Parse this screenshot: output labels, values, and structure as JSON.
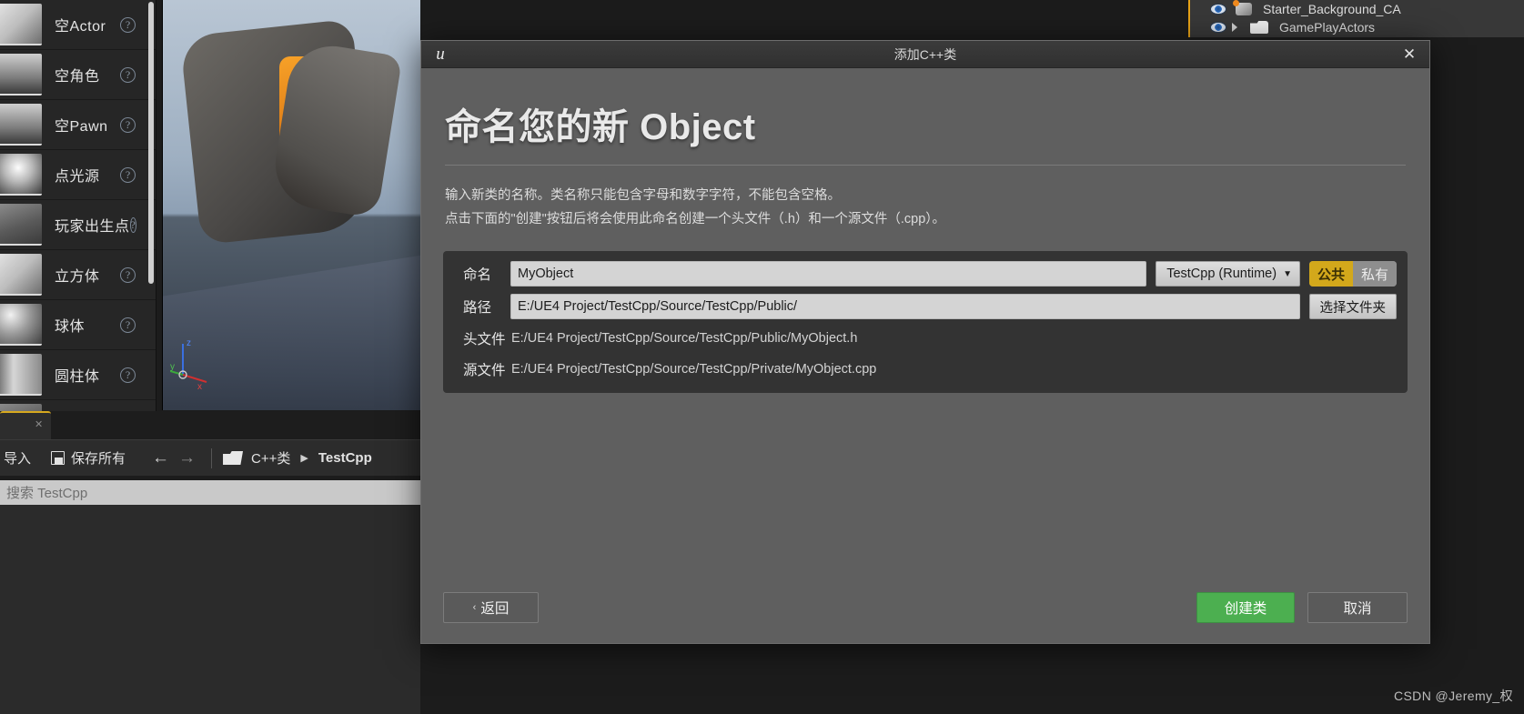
{
  "editor": {
    "place_panel": {
      "items": [
        {
          "label": "空Actor",
          "thumb": "cube",
          "help": "?"
        },
        {
          "label": "空角色",
          "thumb": "pawn",
          "help": "?"
        },
        {
          "label": "空Pawn",
          "thumb": "pawn",
          "help": "?"
        },
        {
          "label": "点光源",
          "thumb": "bulb",
          "help": "?"
        },
        {
          "label": "玩家出生点",
          "thumb": "cube",
          "help": "?"
        },
        {
          "label": "立方体",
          "thumb": "cube",
          "help": "?"
        },
        {
          "label": "球体",
          "thumb": "sphere",
          "help": "?"
        },
        {
          "label": "圆柱体",
          "thumb": "cyl",
          "help": "?"
        }
      ]
    },
    "outliner": {
      "rows": [
        {
          "name": "Starter_Background_CA",
          "type": "mesh"
        },
        {
          "name": "GamePlayActors",
          "type": "folder"
        }
      ]
    },
    "content_browser": {
      "tab_close": "✕",
      "toolbar": {
        "import_label": "导入",
        "save_all_label": "保存所有",
        "back_arrow": "←",
        "forward_arrow": "→",
        "crumb_root": "C++类",
        "crumb_sep": "▶",
        "crumb_current": "TestCpp"
      },
      "search_placeholder": "搜索 TestCpp"
    }
  },
  "dialog": {
    "title": "添加C++类",
    "logo": "unreal-logo",
    "close": "✕",
    "heading": "命名您的新 Object",
    "description": [
      "输入新类的名称。类名称只能包含字母和数字字符，不能包含空格。",
      "点击下面的\"创建\"按钮后将会使用此命名创建一个头文件（.h）和一个源文件（.cpp）。"
    ],
    "form": {
      "name_label": "命名",
      "name_value": "MyObject",
      "module_value": "TestCpp (Runtime)",
      "module_caret": "▼",
      "access_public": "公共",
      "access_private": "私有",
      "access_selected": "公共",
      "path_label": "路径",
      "path_value": "E:/UE4 Project/TestCpp/Source/TestCpp/Public/",
      "choose_folder_label": "选择文件夹",
      "header_label": "头文件",
      "header_value": "E:/UE4 Project/TestCpp/Source/TestCpp/Public/MyObject.h",
      "source_label": "源文件",
      "source_value": "E:/UE4 Project/TestCpp/Source/TestCpp/Private/MyObject.cpp"
    },
    "footer": {
      "back_chevron": "‹",
      "back_label": "返回",
      "create_label": "创建类",
      "cancel_label": "取消"
    },
    "accent_green": "#4caf50",
    "accent_gold": "#d3a81b"
  },
  "watermark": "CSDN @Jeremy_权"
}
